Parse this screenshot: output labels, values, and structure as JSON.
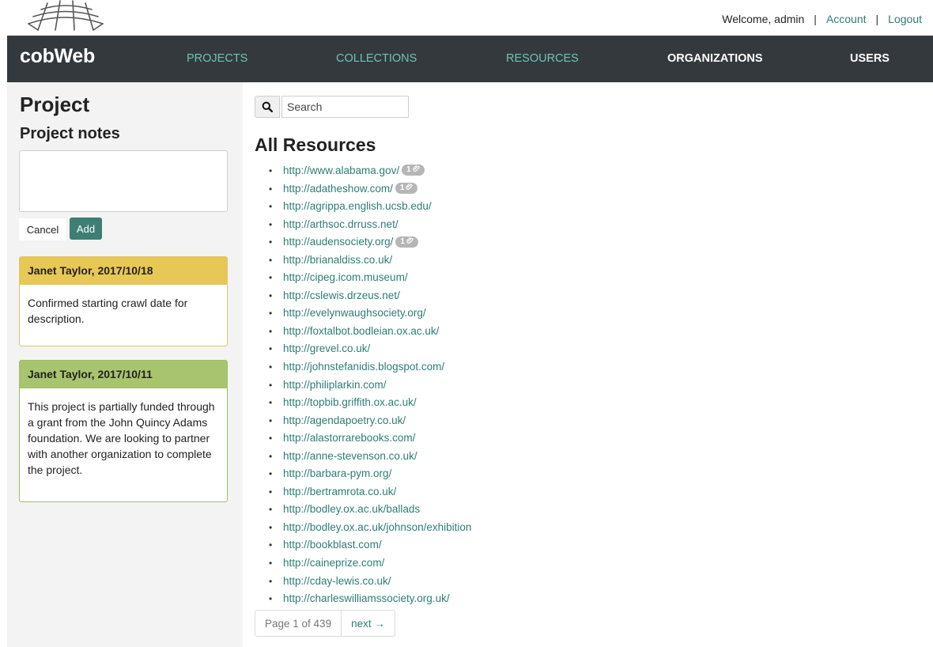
{
  "app": {
    "logo_icon": "web-logo-icon",
    "brand": "cobWeb"
  },
  "userbar": {
    "welcome": "Welcome, admin",
    "separator": "|",
    "account": "Account",
    "logout": "Logout"
  },
  "nav": {
    "items": [
      {
        "label": "PROJECTS"
      },
      {
        "label": "COLLECTIONS"
      },
      {
        "label": "RESOURCES"
      },
      {
        "label": "ORGANIZATIONS"
      },
      {
        "label": "USERS"
      }
    ]
  },
  "sidebar": {
    "title": "Project",
    "subtitle": "Project notes",
    "notes_input_value": "",
    "cancel_label": "Cancel",
    "add_label": "Add",
    "notes": [
      {
        "author_date": "Janet Taylor, 2017/10/18",
        "text": "Confirmed starting crawl date for description.",
        "color": "#e8c854"
      },
      {
        "author_date": "Janet Taylor, 2017/10/11",
        "text": "This project is partially funded through a grant from the John Quincy Adams foundation. We are looking to partner with another organization to complete the project.",
        "color": "#a9c46e"
      }
    ]
  },
  "search": {
    "icon": "search-icon",
    "placeholder": "Search"
  },
  "main": {
    "title": "All Resources",
    "link_color": "#2e7d75",
    "badge_icon": "paperclip-icon",
    "resources": [
      {
        "url": "http://www.alabama.gov/",
        "badge": "1"
      },
      {
        "url": "http://adatheshow.com/",
        "badge": "1"
      },
      {
        "url": "http://agrippa.english.ucsb.edu/"
      },
      {
        "url": "http://arthsoc.drruss.net/"
      },
      {
        "url": "http://audensociety.org/",
        "badge": "1"
      },
      {
        "url": "http://brianaldiss.co.uk/"
      },
      {
        "url": "http://cipeg.icom.museum/"
      },
      {
        "url": "http://cslewis.drzeus.net/"
      },
      {
        "url": "http://evelynwaughsociety.org/"
      },
      {
        "url": "http://foxtalbot.bodleian.ox.ac.uk/"
      },
      {
        "url": "http://grevel.co.uk/"
      },
      {
        "url": "http://johnstefanidis.blogspot.com/"
      },
      {
        "url": "http://philiplarkin.com/"
      },
      {
        "url": "http://topbib.griffith.ox.ac.uk/"
      },
      {
        "url": "http://agendapoetry.co.uk/"
      },
      {
        "url": "http://alastorrarebooks.com/"
      },
      {
        "url": "http://anne-stevenson.co.uk/"
      },
      {
        "url": "http://barbara-pym.org/"
      },
      {
        "url": "http://bertramrota.co.uk/"
      },
      {
        "url": "http://bodley.ox.ac.uk/ballads"
      },
      {
        "url": "http://bodley.ox.ac.uk/johnson/exhibition"
      },
      {
        "url": "http://bookblast.com/"
      },
      {
        "url": "http://caineprize.com/"
      },
      {
        "url": "http://cday-lewis.co.uk/"
      },
      {
        "url": "http://charleswilliamssociety.org.uk/"
      }
    ]
  },
  "pagination": {
    "info": "Page 1 of 439",
    "next": "next →"
  }
}
